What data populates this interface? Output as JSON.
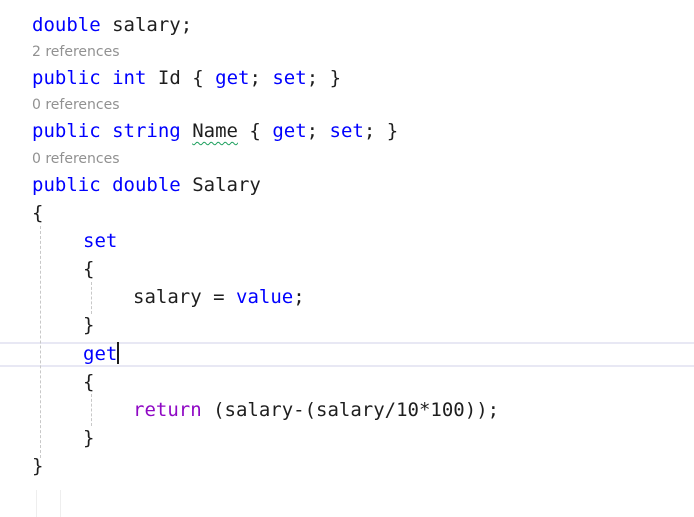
{
  "code": {
    "field_line": {
      "type": "double",
      "name": "salary",
      "semi": ";"
    },
    "lens_1": "2 references",
    "id_line": {
      "mod": "public",
      "type": "int",
      "name": "Id",
      "open": "{",
      "get": "get",
      "set": "set",
      "sep": ";",
      "close": "}"
    },
    "lens_2": "0 references",
    "name_line": {
      "mod": "public",
      "type": "string",
      "name": "Name",
      "open": "{",
      "get": "get",
      "set": "set",
      "sep": ";",
      "close": "}"
    },
    "lens_3": "0 references",
    "salary_line": {
      "mod": "public",
      "type": "double",
      "name": "Salary"
    },
    "brace_open": "{",
    "brace_close": "}",
    "set_kw": "set",
    "set_body": {
      "target": "salary",
      "op": "=",
      "value_kw": "value",
      "semi": ";"
    },
    "get_kw": "get",
    "get_body": {
      "return_kw": "return",
      "expr": "(salary-(salary/10*100))",
      "semi": ";"
    }
  }
}
